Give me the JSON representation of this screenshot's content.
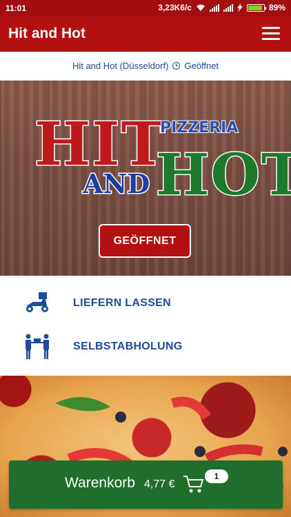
{
  "status_bar": {
    "time": "11:01",
    "network_speed": "3,23K6/c",
    "battery": "89%",
    "battery_level": 0.89
  },
  "app_bar": {
    "title": "Hit and Hot",
    "menu_icon": "hamburger-menu-icon"
  },
  "info_bar": {
    "location": "Hit and Hot (Düsseldorf)",
    "status_icon": "clock-icon",
    "status": "Geöffnet"
  },
  "hero": {
    "logo_words": [
      "HIT",
      "AND",
      "HOT",
      "PIZZERIA"
    ],
    "open_button": "GEÖFFNET"
  },
  "options": [
    {
      "label": "LIEFERN LASSEN",
      "icon": "delivery-scooter-icon"
    },
    {
      "label": "SELBSTABHOLUNG",
      "icon": "pickup-handover-icon"
    }
  ],
  "basket": {
    "label": "Warenkorb",
    "price": "4,77 €",
    "icon": "cart-icon",
    "count": "1"
  },
  "colors": {
    "brand_red": "#b3110f",
    "link_blue": "#1d4c9b",
    "basket_green": "#1f6e2b"
  }
}
